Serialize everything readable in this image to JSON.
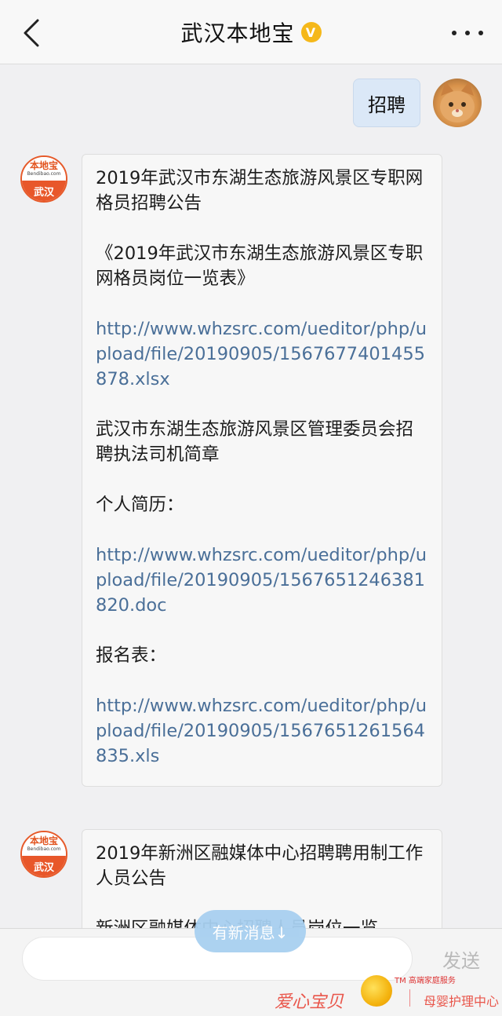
{
  "header": {
    "title": "武汉本地宝",
    "verified_mark": "V"
  },
  "chat": {
    "my_message": "招聘",
    "sender": {
      "brand_name": "本地宝",
      "brand_url": "Bendibao.com",
      "city": "武汉"
    },
    "message1": {
      "title": "2019年武汉市东湖生态旅游风景区专职网格员招聘公告",
      "table_title": "《2019年武汉市东湖生态旅游风景区专职网格员岗位一览表》",
      "link1": "http://www.whzsrc.com/ueditor/php/upload/file/20190905/1567677401455878.xlsx",
      "driver_notice": "武汉市东湖生态旅游风景区管理委员会招聘执法司机简章",
      "resume_label": "个人简历：",
      "link2": "http://www.whzsrc.com/ueditor/php/upload/file/20190905/1567651246381820.doc",
      "form_label": "报名表：",
      "link3": "http://www.whzsrc.com/ueditor/php/upload/file/20190905/1567651261564835.xls"
    },
    "message2": {
      "title": "2019年新洲区融媒体中心招聘聘用制工作人员公告",
      "preview": "新洲区融媒体中心招聘人员岗位一览"
    }
  },
  "new_message_badge": "有新消息↓",
  "input_bar": {
    "send_label": "发送"
  },
  "watermark": {
    "left_text": "爱心宝贝",
    "tm_text": "TM 高端家庭服务",
    "right_text": "母婴护理中心"
  }
}
